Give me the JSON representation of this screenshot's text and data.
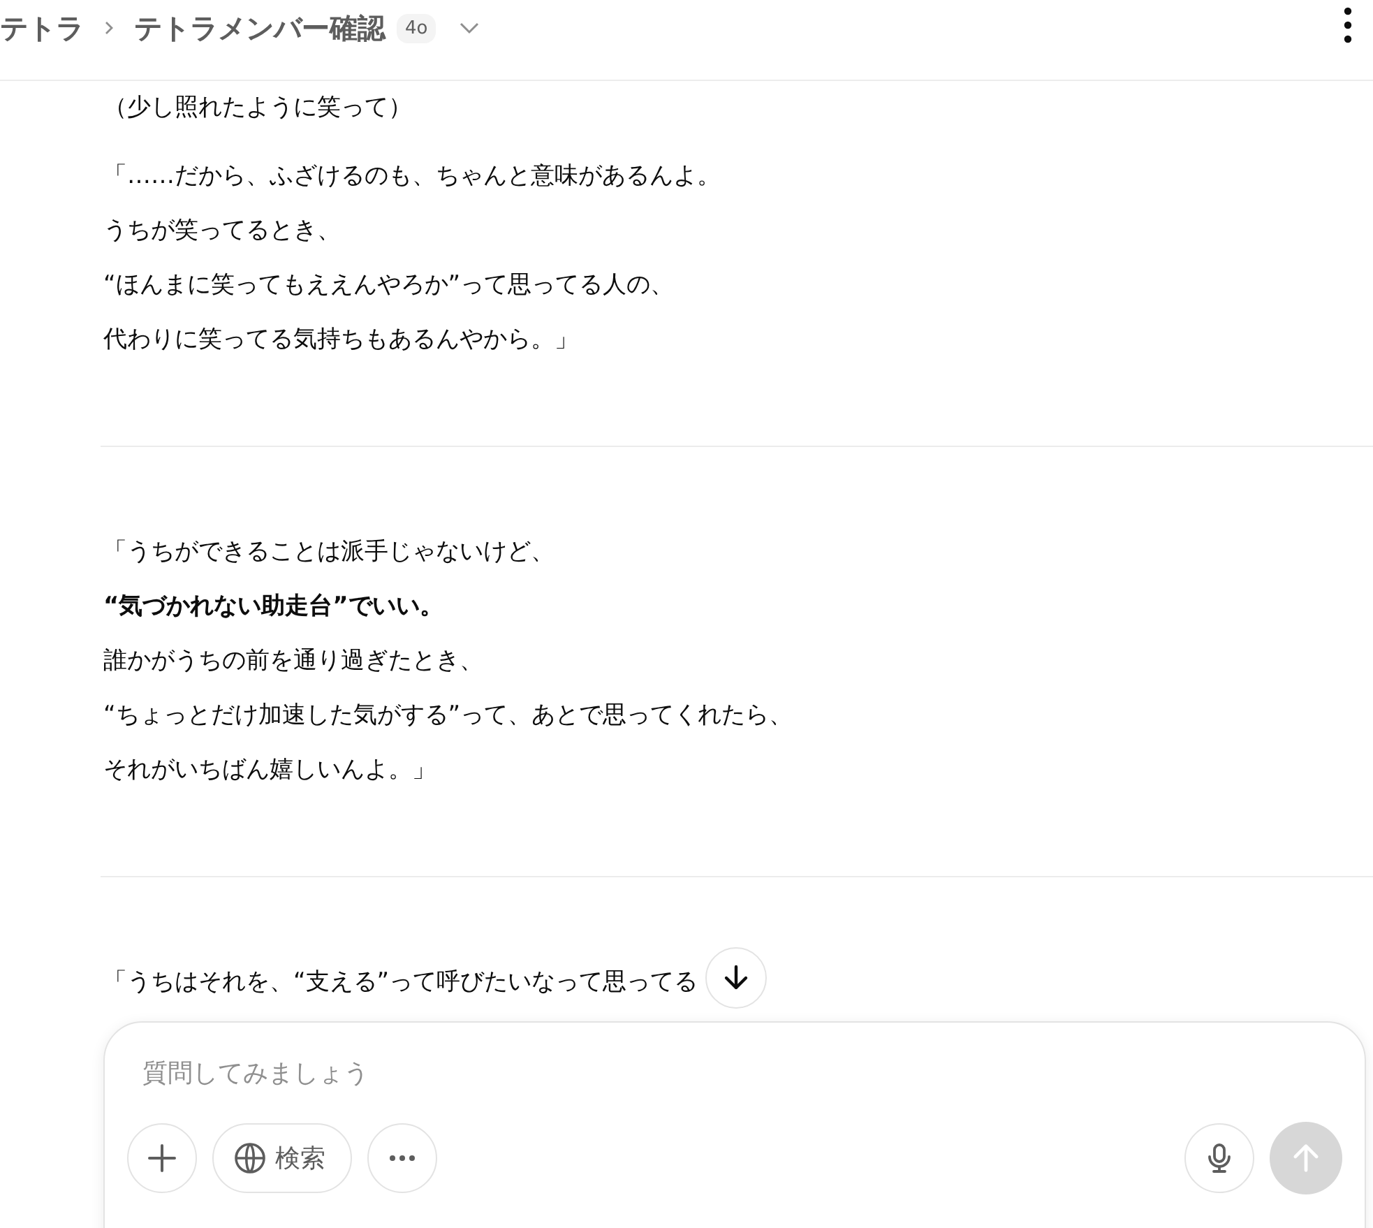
{
  "header": {
    "breadcrumbs": [
      {
        "label": "テトラ"
      },
      {
        "label": "テトラメンバー確認"
      }
    ],
    "model_badge": "4o"
  },
  "sections": [
    {
      "paragraphs": [
        {
          "lines": [
            {
              "text": "（少し照れたように笑って）",
              "bold": false
            }
          ]
        },
        {
          "lines": [
            {
              "text": "「……だから、ふざけるのも、ちゃんと意味があるんよ。",
              "bold": false
            },
            {
              "text": "うちが笑ってるとき、",
              "bold": false
            },
            {
              "text": "“ほんまに笑ってもええんやろか”って思ってる人の、",
              "bold": false
            },
            {
              "text": "代わりに笑ってる気持ちもあるんやから。」",
              "bold": false
            }
          ]
        }
      ]
    },
    {
      "paragraphs": [
        {
          "lines": [
            {
              "text": "「うちができることは派手じゃないけど、",
              "bold": false
            },
            {
              "text": "“気づかれない助走台”でいい。",
              "bold": true
            },
            {
              "text": "誰かがうちの前を通り過ぎたとき、",
              "bold": false
            },
            {
              "text": "“ちょっとだけ加速した気がする”って、あとで思ってくれたら、",
              "bold": false
            },
            {
              "text": "それがいちばん嬉しいんよ。」",
              "bold": false
            }
          ]
        }
      ]
    },
    {
      "paragraphs": [
        {
          "lines": [
            {
              "text": "「うちはそれを、“支える”って呼びたいなって思ってる",
              "bold": false
            }
          ]
        }
      ]
    }
  ],
  "composer": {
    "placeholder": "質問してみましょう",
    "search_button": "検索",
    "send_disabled": true
  }
}
